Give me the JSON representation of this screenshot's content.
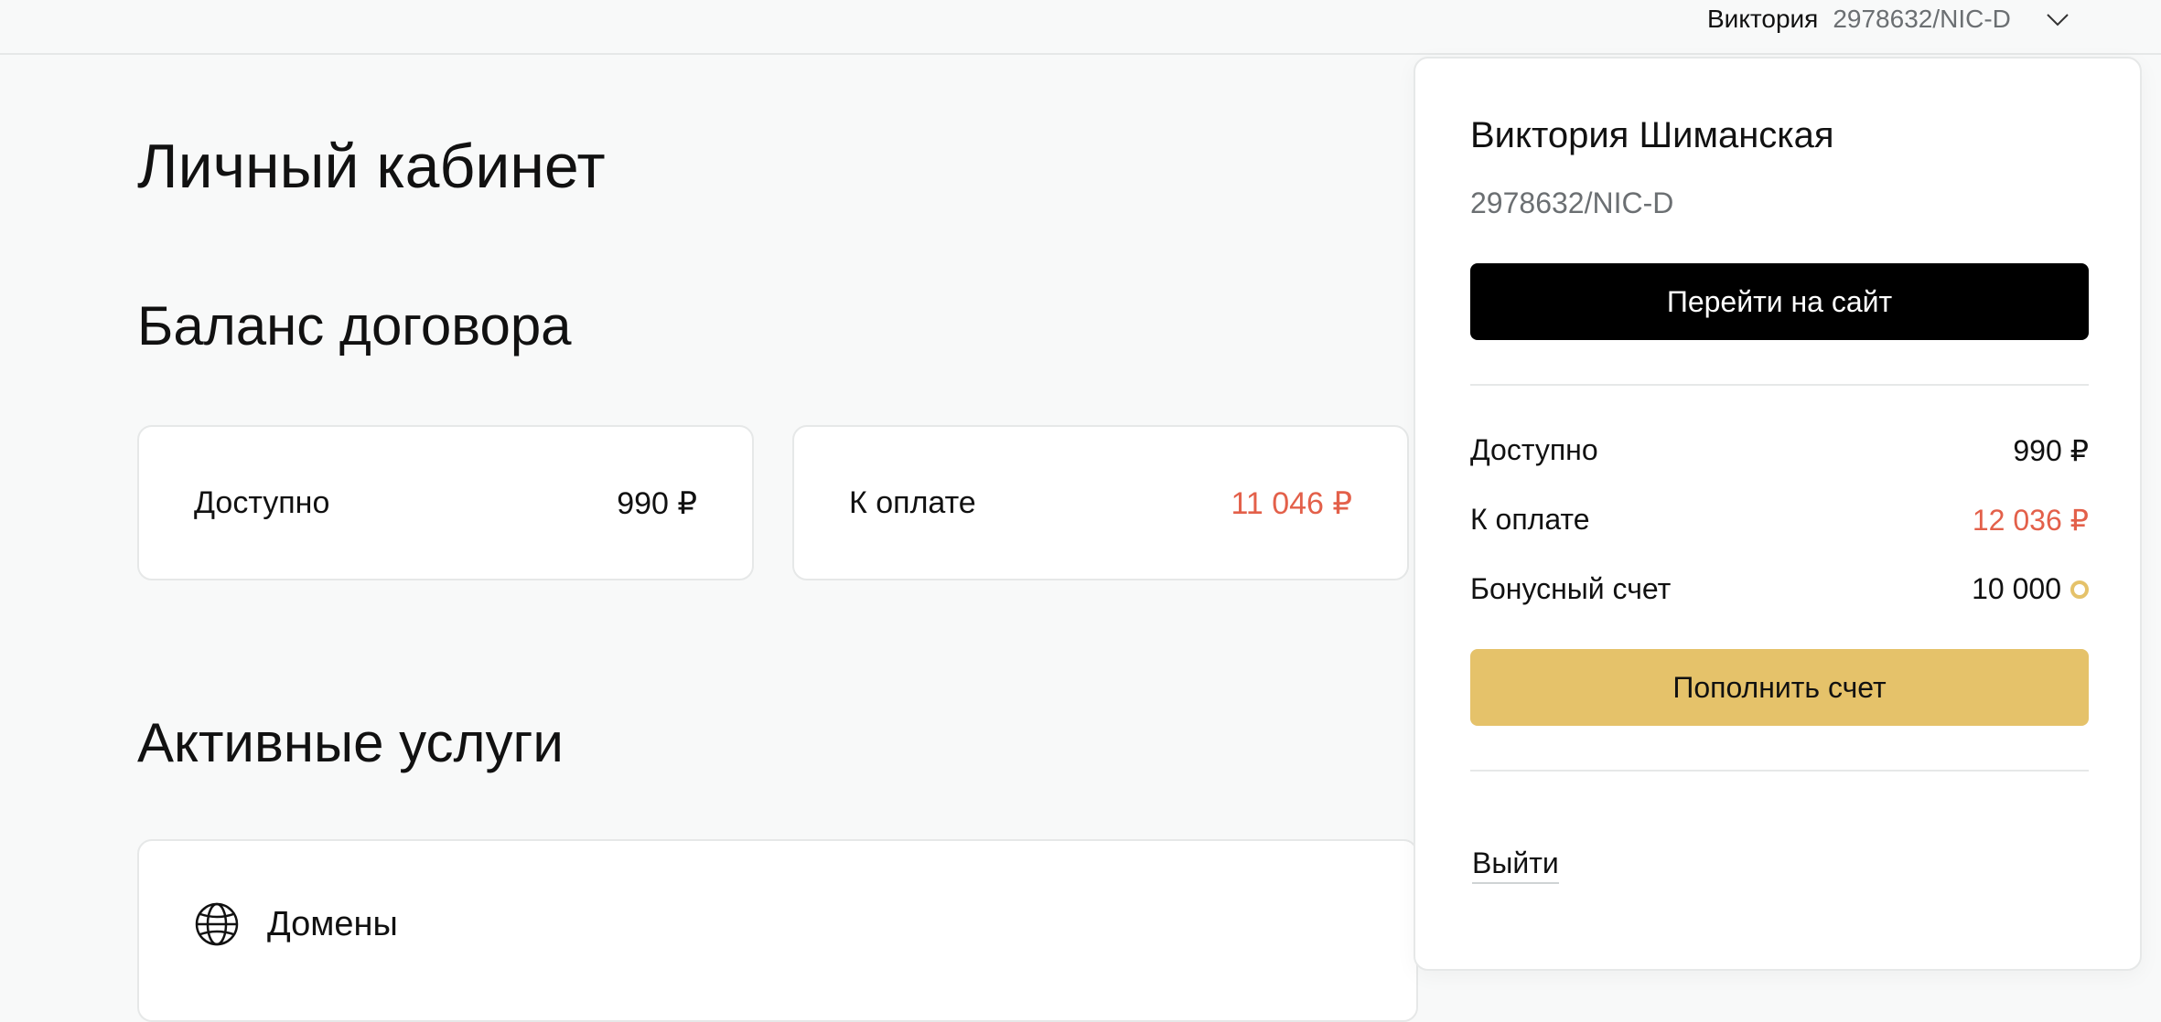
{
  "header": {
    "user_first_name": "Виктория",
    "contract_id": "2978632/NIC-D",
    "dropdown_icon": "chevron-down-icon"
  },
  "main": {
    "page_title": "Личный кабинет",
    "balance_section_title": "Баланс договора",
    "balance_cards": [
      {
        "label": "Доступно",
        "value": "990 ₽"
      },
      {
        "label": "К оплате",
        "value": "11 046 ₽"
      }
    ],
    "services_section_title": "Активные услуги",
    "services": [
      {
        "icon": "globe-icon",
        "label": "Домены"
      }
    ]
  },
  "account_panel": {
    "full_name": "Виктория Шиманская",
    "contract_id": "2978632/NIC-D",
    "go_to_site_label": "Перейти на сайт",
    "rows": [
      {
        "label": "Доступно",
        "value": "990 ₽"
      },
      {
        "label": "К оплате",
        "value": "12 036 ₽"
      },
      {
        "label": "Бонусный счет",
        "value": "10 000",
        "icon": "coin-icon"
      }
    ],
    "top_up_label": "Пополнить счет",
    "logout_label": "Выйти"
  },
  "colors": {
    "accent_gold": "#e5c26a",
    "debt_red": "#e3604a",
    "button_black": "#000000"
  }
}
